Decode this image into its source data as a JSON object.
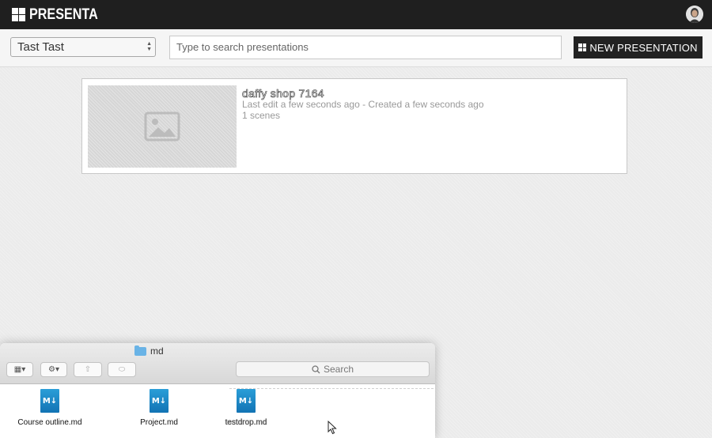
{
  "app": {
    "brand": "PRESENTA"
  },
  "toolbar": {
    "workspace_selected": "Tast Tast",
    "search_placeholder": "Type to search presentations",
    "new_button_label": "NEW PRESENTATION"
  },
  "presentations": [
    {
      "title": "daffy shop 7164",
      "meta": "Last edit a few seconds ago - Created a few seconds ago",
      "scenes": "1 scenes"
    }
  ],
  "finder": {
    "folder_name": "md",
    "search_label": "Search",
    "files": [
      {
        "name": "Course outline.md",
        "icon": "M↓"
      },
      {
        "name": "Project.md",
        "icon": "M↓"
      },
      {
        "name": "testdrop.md",
        "icon": "M↓"
      }
    ]
  }
}
